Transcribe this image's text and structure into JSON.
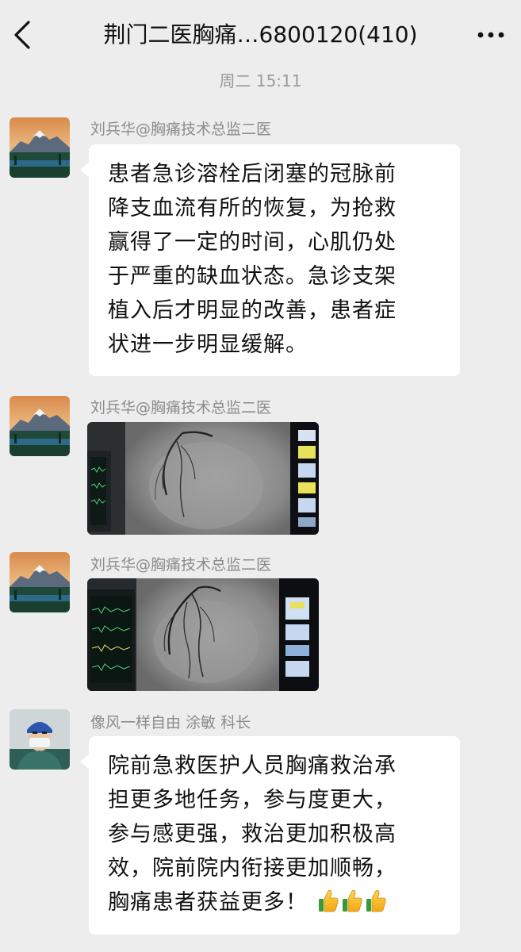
{
  "header": {
    "title": "荆门二医胸痛…6800120(410)",
    "back_icon": "chevron-left-icon",
    "more_icon": "more-dots-icon"
  },
  "timestamp": "周二 15:11",
  "messages": [
    {
      "type": "text",
      "sender": "刘兵华@胸痛技术总监二医",
      "avatar": "mountain-landscape-avatar",
      "lines": [
        "患者急诊溶栓后闭塞的冠脉前",
        "降支血流有所的恢复，为抢救",
        "赢得了一定的时间，心肌仍处",
        "于严重的缺血状态。急诊支架",
        "植入后才明显的改善，患者症",
        "状进一步明显缓解。"
      ]
    },
    {
      "type": "image",
      "sender": "刘兵华@胸痛技术总监二医",
      "avatar": "mountain-landscape-avatar",
      "image": "angiography-photo-1"
    },
    {
      "type": "image",
      "sender": "刘兵华@胸痛技术总监二医",
      "avatar": "mountain-landscape-avatar",
      "image": "angiography-photo-2"
    },
    {
      "type": "text",
      "sender": "像风一样自由 涂敏 科长",
      "avatar": "surgeon-avatar",
      "lines": [
        "院前急救医护人员胸痛救治承",
        "担更多地任务，参与度更大，",
        "参与感更强，救治更加积极高",
        "效，院前院内衔接更加顺畅，",
        "胸痛患者获益更多！"
      ],
      "emojis": [
        "thumbs-up-icon",
        "thumbs-up-icon",
        "thumbs-up-icon"
      ]
    }
  ],
  "colors": {
    "background": "#ededed",
    "bubble": "#ffffff",
    "meta_text": "#9a9a9a"
  }
}
